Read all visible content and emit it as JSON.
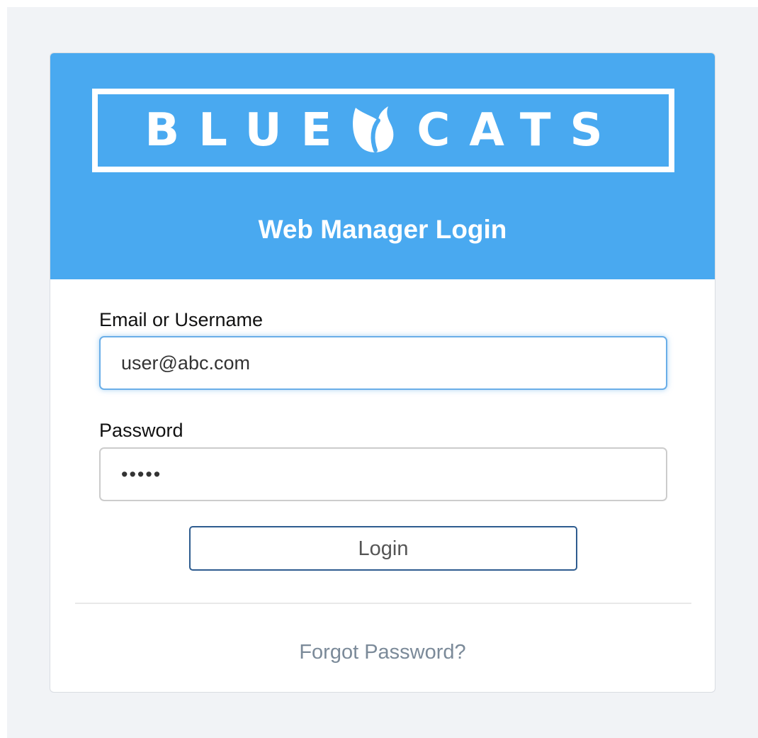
{
  "brand": {
    "logo_left_word": "BLUE",
    "logo_right_word": "CATS",
    "logo_mark_icon": "cat-head-icon",
    "header_color": "#49a9f0"
  },
  "login": {
    "title": "Web Manager Login",
    "email_label": "Email or Username",
    "email_value": "user@abc.com",
    "password_label": "Password",
    "password_value": "•••••",
    "login_button": "Login",
    "forgot_link": "Forgot Password?"
  }
}
